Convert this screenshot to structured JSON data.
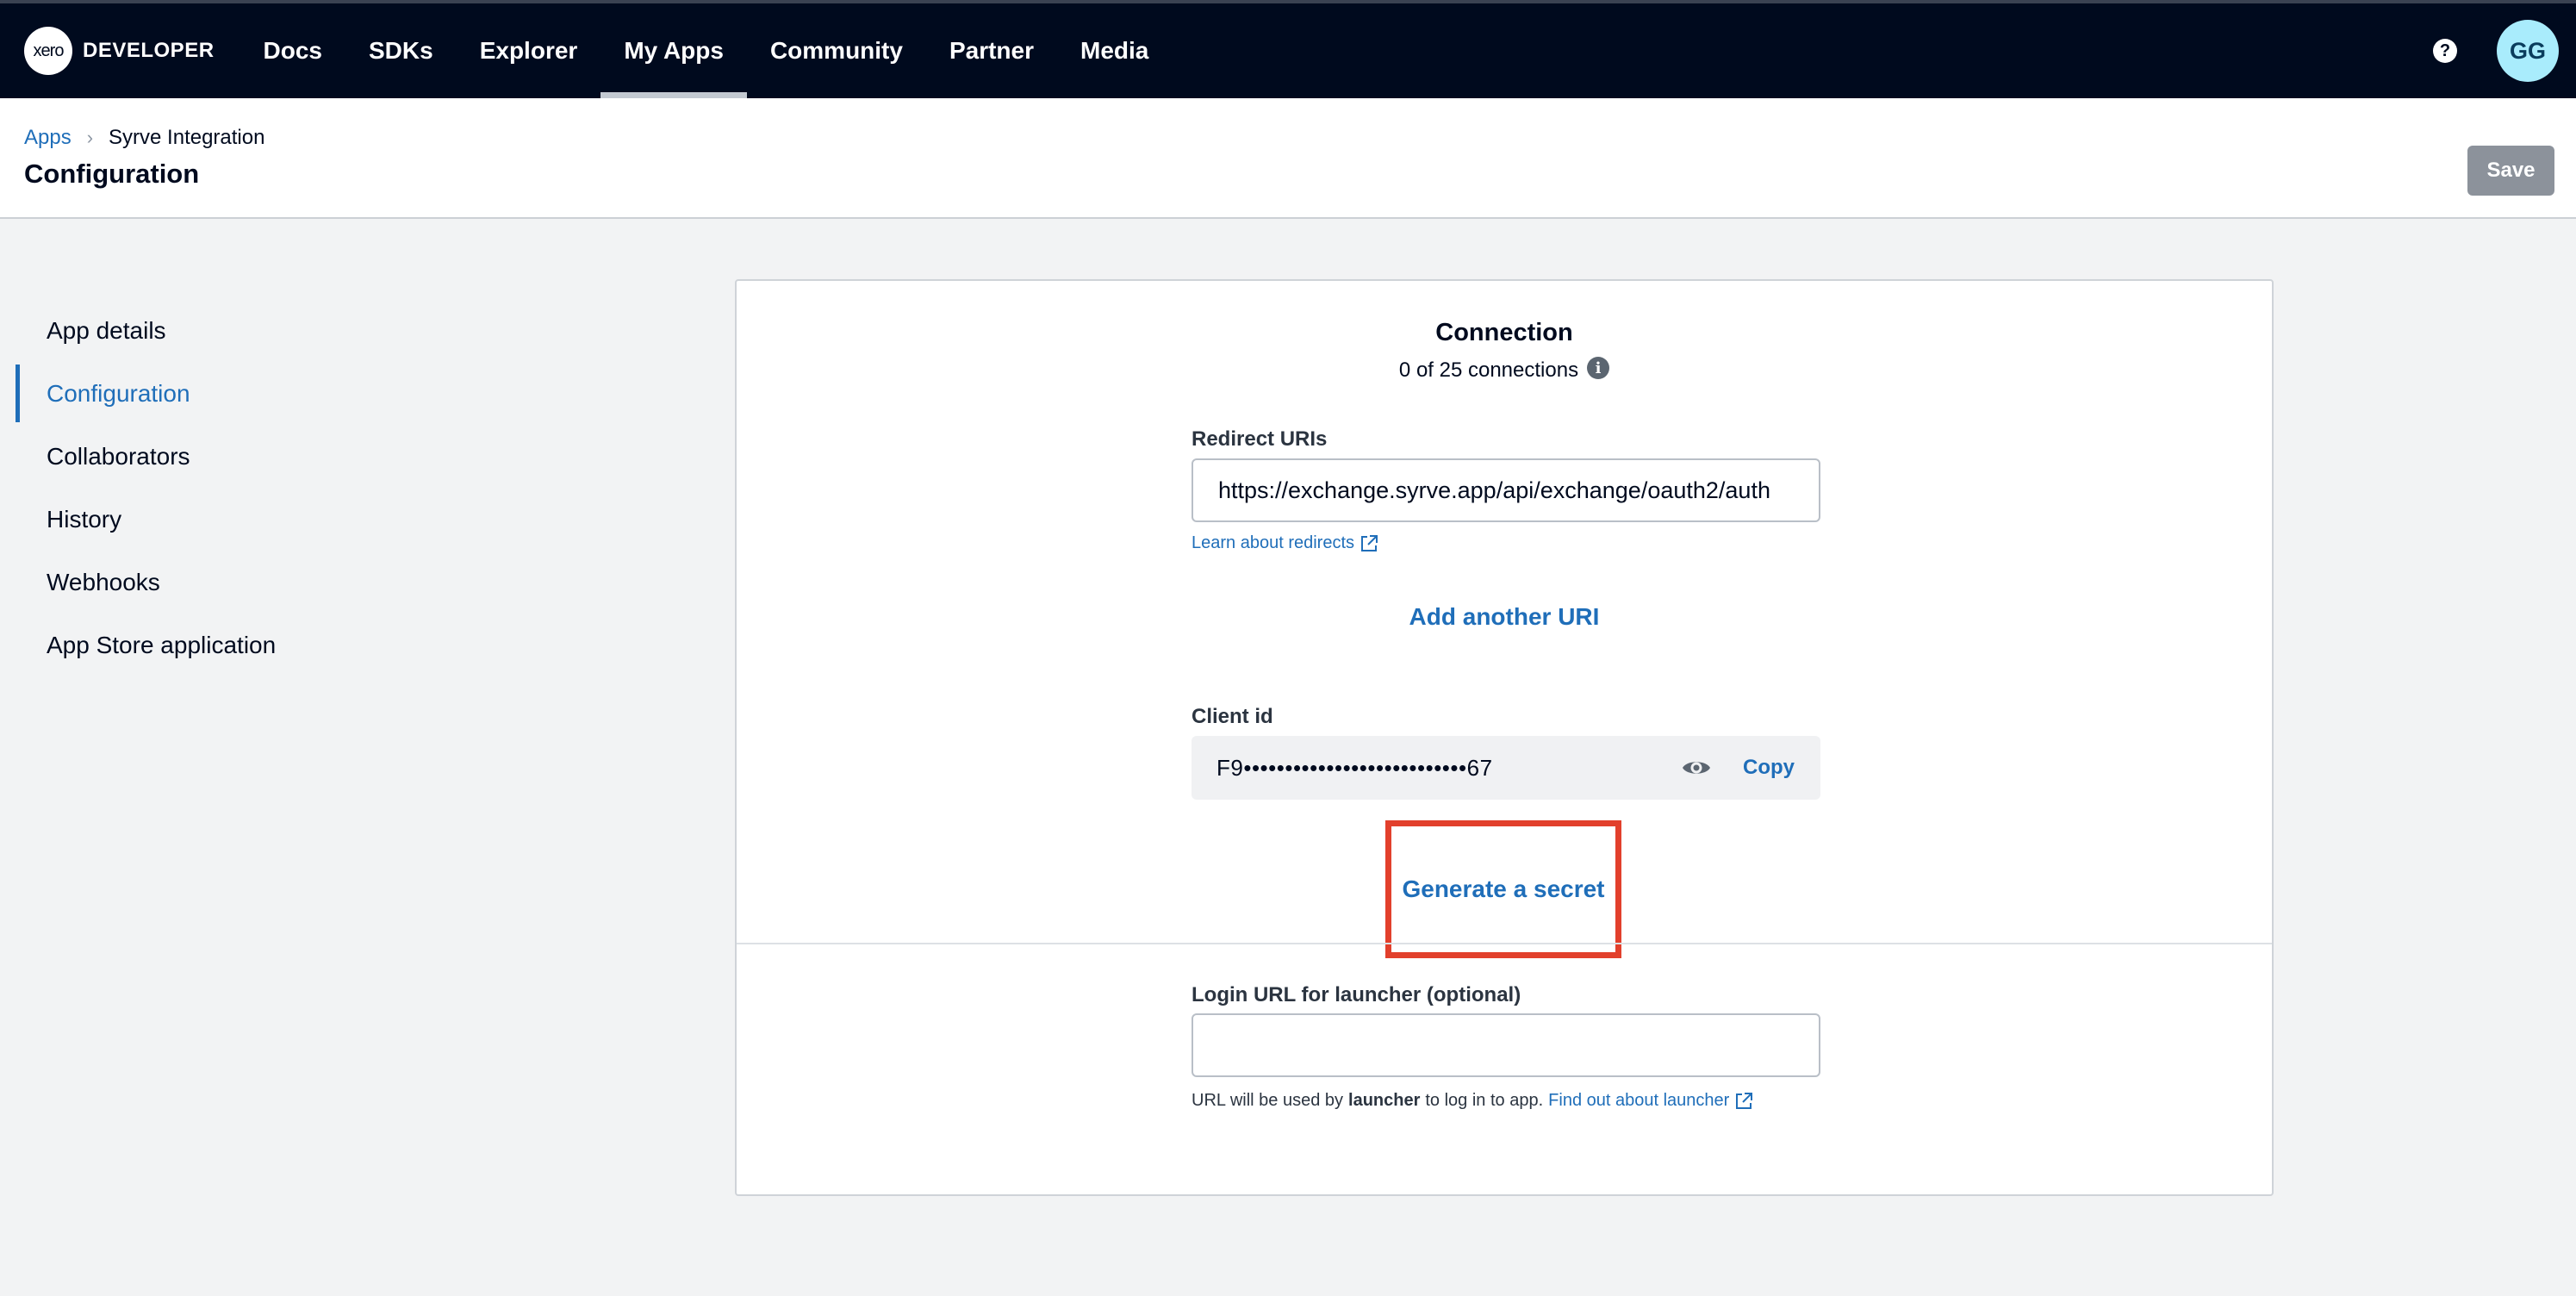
{
  "topnav": {
    "logo_text": "xero",
    "brand": "DEVELOPER",
    "items": [
      {
        "label": "Docs"
      },
      {
        "label": "SDKs"
      },
      {
        "label": "Explorer"
      },
      {
        "label": "My Apps"
      },
      {
        "label": "Community"
      },
      {
        "label": "Partner"
      },
      {
        "label": "Media"
      }
    ],
    "active_item": "My Apps",
    "help_icon": "?",
    "avatar_initials": "GG"
  },
  "header": {
    "breadcrumb": {
      "link": "Apps",
      "separator": "›",
      "current": "Syrve Integration"
    },
    "title": "Configuration",
    "save_label": "Save"
  },
  "sidebar": {
    "items": [
      {
        "label": "App details"
      },
      {
        "label": "Configuration"
      },
      {
        "label": "Collaborators"
      },
      {
        "label": "History"
      },
      {
        "label": "Webhooks"
      },
      {
        "label": "App Store application"
      }
    ],
    "active_item": "Configuration"
  },
  "connection": {
    "title": "Connection",
    "count_text": "0 of 25 connections",
    "info_icon": "i",
    "redirect_label": "Redirect URIs",
    "redirect_value": "https://exchange.syrve.app/api/exchange/oauth2/auth",
    "learn_link": "Learn about redirects",
    "add_uri": "Add another URI",
    "client_id_label": "Client id",
    "client_id_value": "F9•••••••••••••••••••••••••••67",
    "copy_label": "Copy",
    "generate_secret": "Generate a secret",
    "login_label": "Login URL for launcher (optional)",
    "login_value": "",
    "help_prefix": "URL will be used by",
    "help_bold": "launcher",
    "help_suffix": "to log in to app.",
    "help_link": "Find out about launcher"
  },
  "colors": {
    "nav_bg": "#000a1e",
    "link": "#1f6eb9",
    "highlight": "#e2402c",
    "avatar_bg": "#a9ecfc",
    "save_bg": "#8c929b"
  }
}
